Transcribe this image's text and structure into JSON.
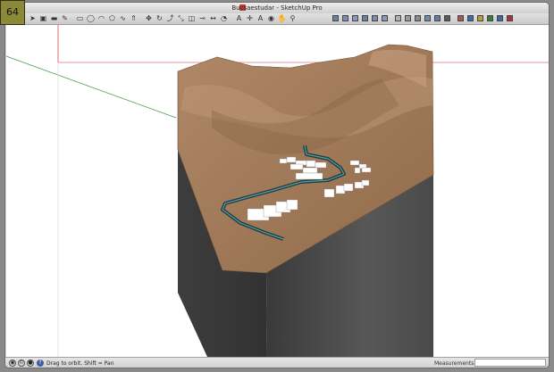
{
  "window": {
    "title": "Bucsaestudar - SketchUp Pro"
  },
  "badge": {
    "text": "64"
  },
  "toolbar": {
    "tools": [
      {
        "name": "select-tool",
        "icon": "arrow-icon",
        "glyph": "➤"
      },
      {
        "name": "paint-tool",
        "icon": "paint-bucket-icon",
        "glyph": "▣"
      },
      {
        "name": "eraser-tool",
        "icon": "eraser-icon",
        "glyph": "▬"
      },
      {
        "name": "line-tool",
        "icon": "pencil-icon",
        "glyph": "✎"
      },
      {
        "name": "rectangle-tool",
        "icon": "rectangle-icon",
        "glyph": "▭"
      },
      {
        "name": "circle-tool",
        "icon": "circle-icon",
        "glyph": "◯"
      },
      {
        "name": "arc-tool",
        "icon": "arc-icon",
        "glyph": "◠"
      },
      {
        "name": "polygon-tool",
        "icon": "polygon-icon",
        "glyph": "⬠"
      },
      {
        "name": "freehand-tool",
        "icon": "freehand-icon",
        "glyph": "∿"
      },
      {
        "name": "push-pull-tool",
        "icon": "push-pull-icon",
        "glyph": "⇑"
      },
      {
        "name": "move-tool",
        "icon": "move-icon",
        "glyph": "✥"
      },
      {
        "name": "rotate-tool",
        "icon": "rotate-icon",
        "glyph": "↻"
      },
      {
        "name": "follow-me-tool",
        "icon": "follow-me-icon",
        "glyph": "⤴"
      },
      {
        "name": "scale-tool",
        "icon": "scale-icon",
        "glyph": "⤡"
      },
      {
        "name": "offset-tool",
        "icon": "offset-icon",
        "glyph": "◫"
      },
      {
        "name": "tape-tool",
        "icon": "tape-measure-icon",
        "glyph": "⊸"
      },
      {
        "name": "dimension-tool",
        "icon": "dimension-icon",
        "glyph": "↔"
      },
      {
        "name": "protractor-tool",
        "icon": "protractor-icon",
        "glyph": "◔"
      },
      {
        "name": "text-tool",
        "icon": "text-icon",
        "glyph": "A"
      },
      {
        "name": "axes-tool",
        "icon": "axes-icon",
        "glyph": "✛"
      },
      {
        "name": "3d-text-tool",
        "icon": "3d-text-icon",
        "glyph": "A"
      },
      {
        "name": "orbit-tool",
        "icon": "orbit-icon",
        "glyph": "◉"
      },
      {
        "name": "pan-tool",
        "icon": "hand-icon",
        "glyph": "✋"
      },
      {
        "name": "zoom-tool",
        "icon": "magnifier-icon",
        "glyph": "⚲"
      }
    ],
    "views": [
      {
        "name": "view-iso",
        "icon": "iso-view-icon"
      },
      {
        "name": "view-top",
        "icon": "top-view-icon"
      },
      {
        "name": "view-front",
        "icon": "front-view-icon"
      },
      {
        "name": "view-right",
        "icon": "right-view-icon"
      },
      {
        "name": "view-back",
        "icon": "back-view-icon"
      },
      {
        "name": "view-left",
        "icon": "left-view-icon"
      },
      {
        "name": "style-xray",
        "icon": "xray-icon"
      },
      {
        "name": "style-wireframe",
        "icon": "wireframe-icon"
      },
      {
        "name": "style-hidden-line",
        "icon": "hidden-line-icon"
      },
      {
        "name": "style-shaded",
        "icon": "shaded-icon"
      },
      {
        "name": "style-textured",
        "icon": "textured-icon"
      },
      {
        "name": "style-monochrome",
        "icon": "monochrome-icon"
      },
      {
        "name": "section-plane",
        "icon": "section-plane-icon"
      },
      {
        "name": "components",
        "icon": "components-icon"
      },
      {
        "name": "get-models",
        "icon": "warehouse-icon"
      },
      {
        "name": "share-model",
        "icon": "share-icon"
      },
      {
        "name": "google-earth",
        "icon": "earth-icon"
      },
      {
        "name": "extension-warehouse",
        "icon": "extension-icon"
      }
    ]
  },
  "status": {
    "hint": "Drag to orbit.  Shift = Pan",
    "measurements_label": "Measurements",
    "measurements_value": ""
  },
  "colors": {
    "terrain": "#9a7352",
    "terrain_light": "#b0896a",
    "side_dark": "#3f3f3f",
    "side_front": "#4d4d4d",
    "road": "#2f5a5e",
    "building": "#ffffff",
    "axis_green": "#2c8a2c",
    "axis_red": "#cc3333"
  }
}
